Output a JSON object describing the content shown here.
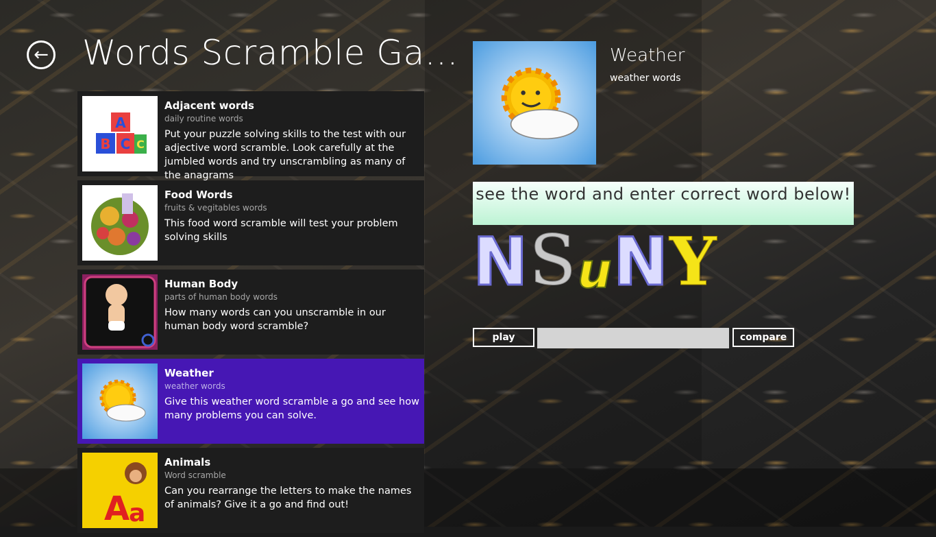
{
  "app": {
    "title": "Words Scramble Ga..."
  },
  "categories": [
    {
      "title": "Adjacent words",
      "subtitle": "daily routine words",
      "description": "Put your puzzle solving skills to the test with our adjective word scramble. Look carefully at the jumbled words and try unscrambling as many of the anagrams",
      "icon": "abc-blocks-icon",
      "selected": false
    },
    {
      "title": "Food Words",
      "subtitle": "fruits & vegitables words",
      "description": "This food word scramble will test your problem solving skills",
      "icon": "food-collage-icon",
      "selected": false
    },
    {
      "title": "Human Body",
      "subtitle": "parts of human body words",
      "description": "How many words can you unscramble in our human body word scramble?",
      "icon": "baby-body-icon",
      "selected": false
    },
    {
      "title": "Weather",
      "subtitle": "weather words",
      "description": "Give this weather word scramble a go and see how many problems you can solve.",
      "icon": "sun-cloud-icon",
      "selected": true
    },
    {
      "title": "Animals",
      "subtitle": "Word scramble",
      "description": "Can you rearrange the letters to make the names of animals? Give it a go and find out!",
      "icon": "monkey-letters-icon",
      "selected": false
    }
  ],
  "detail": {
    "title": "Weather",
    "subtitle": "weather words",
    "instruction": "see the word and enter correct word below!",
    "scrambled_letters": [
      {
        "char": "N",
        "color": "#dcdcff"
      },
      {
        "char": "S",
        "color": "#c8c8c8"
      },
      {
        "char": "u",
        "color": "#f5e418"
      },
      {
        "char": "N",
        "color": "#dcdcff"
      },
      {
        "char": "Y",
        "color": "#f5e418"
      }
    ],
    "play_label": "play",
    "compare_label": "compare",
    "answer_value": ""
  },
  "colors": {
    "selected_item": "#4617b4",
    "item_bg": "#1d1d1d",
    "instruction_bg": "#bdf3d4"
  }
}
